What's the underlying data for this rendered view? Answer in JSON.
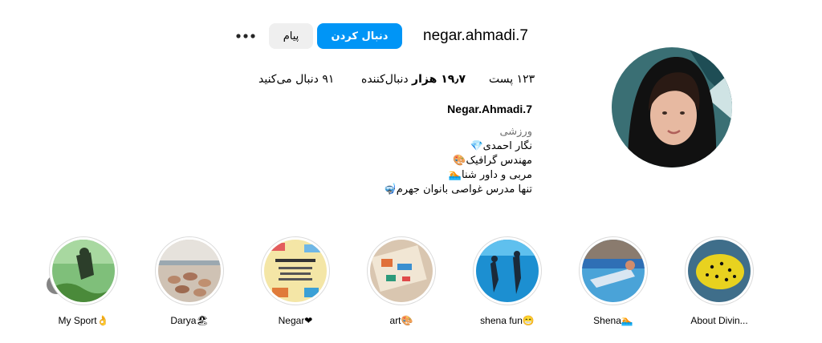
{
  "profile": {
    "username": "negar.ahmadi.7",
    "full_name": "Negar.Ahmadi.7",
    "follow_label": "دنبال کردن",
    "message_label": "پیام",
    "more_icon": "ellipsis-icon"
  },
  "stats": {
    "posts": "۱۲۳ پست",
    "followers_count": "۱۹٫۷ هزار",
    "followers_label": "دنبال‌کننده",
    "following": "۹۱ دنبال می‌کنید"
  },
  "bio": {
    "category": "ورزشی",
    "lines": [
      "نگار احمدی💎",
      "مهندس گرافیک🎨",
      "مربی و داور شنا🏊",
      "تنها مدرس غواصی بانوان جهرم🤿"
    ]
  },
  "highlights": [
    {
      "label": "About Divin..."
    },
    {
      "label": "Shena🏊"
    },
    {
      "label": "shena fun😁"
    },
    {
      "label": "art🎨"
    },
    {
      "label": "Negar❤"
    },
    {
      "label": "Darya🏖"
    },
    {
      "label": "My Sport👌"
    }
  ],
  "colors": {
    "primary_button": "#0095f6",
    "secondary_button": "#efefef",
    "muted_text": "#737373"
  }
}
